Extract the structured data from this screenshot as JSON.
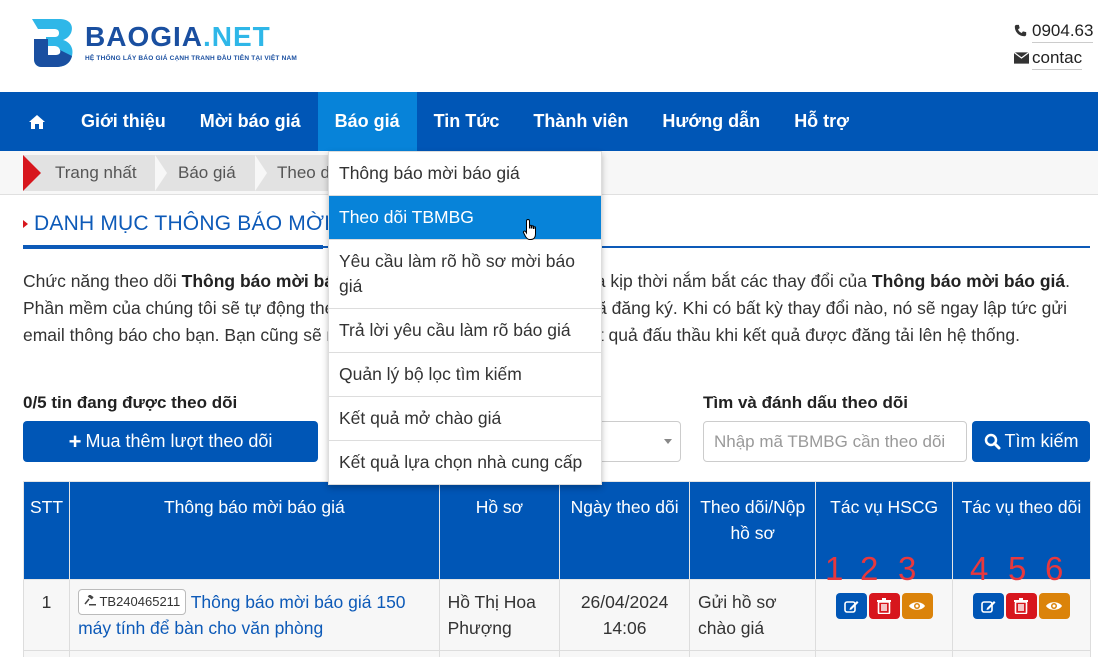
{
  "brand": {
    "name_part1": "BAOGIA",
    "name_part2": ".NET",
    "tagline": "HỆ THỐNG LẤY BÁO GIÁ CẠNH TRANH ĐẦU TIÊN TẠI VIỆT NAM",
    "colors": {
      "primary": "#1a4fa0",
      "accent": "#2fb7e8"
    }
  },
  "contact": {
    "phone": "0904.63",
    "email": "contac",
    "phone_icon": "phone-icon",
    "email_icon": "envelope-icon"
  },
  "nav": {
    "home_icon": "home-icon",
    "items": [
      {
        "label": "Giới thiệu"
      },
      {
        "label": "Mời báo giá"
      },
      {
        "label": "Báo giá",
        "active": true
      },
      {
        "label": "Tin Tức"
      },
      {
        "label": "Thành viên"
      },
      {
        "label": "Hướng dẫn"
      },
      {
        "label": "Hỗ trợ"
      }
    ]
  },
  "breadcrumb": [
    "Trang nhất",
    "Báo giá",
    "Theo d"
  ],
  "dropdown": {
    "items": [
      {
        "label": "Thông báo mời báo giá"
      },
      {
        "label": "Theo dõi TBMBG",
        "active": true
      },
      {
        "label": "Yêu cầu làm rõ hồ sơ mời báo giá"
      },
      {
        "label": "Trả lời yêu cầu làm rõ báo giá"
      },
      {
        "label": "Quản lý bộ lọc tìm kiếm"
      },
      {
        "label": "Kết quả mở chào giá"
      },
      {
        "label": "Kết quả lựa chọn nhà cung cấp"
      }
    ]
  },
  "page": {
    "title": "DANH MỤC THÔNG BÁO MỜI BÁO GIÁ",
    "intro": {
      "p1": "Chức năng theo dõi ",
      "b1": "Thông báo mời báo giá",
      "p2": " giúp bạn theo dõi dễ dàng và kịp thời nắm bắt các thay đổi của ",
      "b2": "Thông báo mời báo giá",
      "p3": ". Phần mềm của chúng tôi sẽ tự động theo dõi các gói chào hàng mà bạn đã đăng ký. Khi có bất kỳ thay đổi nào, nó sẽ ngay lập tức gửi email thông báo cho bạn. Bạn cũng sẽ nhận được thông báo qua email kết quả đấu thầu khi kết quả được đăng tải lên hệ thống."
    }
  },
  "controls": {
    "follow_count": "0/5 tin đang được theo dõi",
    "buy_button": "Mua thêm lượt theo dõi",
    "search_label": "Tìm và đánh dấu theo dõi",
    "search_placeholder": "Nhập mã TBMBG cần theo dõi",
    "search_value": "",
    "search_button": "Tìm kiếm"
  },
  "table": {
    "headers": [
      "STT",
      "Thông báo mời báo giá",
      "Hồ sơ",
      "Ngày theo dõi",
      "Theo dõi/Nộp hồ sơ",
      "Tác vụ HSCG",
      "Tác vụ theo dõi"
    ],
    "rows": [
      {
        "stt": "1",
        "code": "TB240465211",
        "title": "Thông báo mời báo giá 150 máy tính để bàn cho văn phòng",
        "owner": "Hồ Thị Hoa Phượng",
        "date": "26/04/2024",
        "time": "14:06",
        "status": "Gửi hồ sơ chào giá"
      }
    ],
    "action_labels": [
      "1",
      "2",
      "3",
      "4",
      "5",
      "6"
    ]
  }
}
